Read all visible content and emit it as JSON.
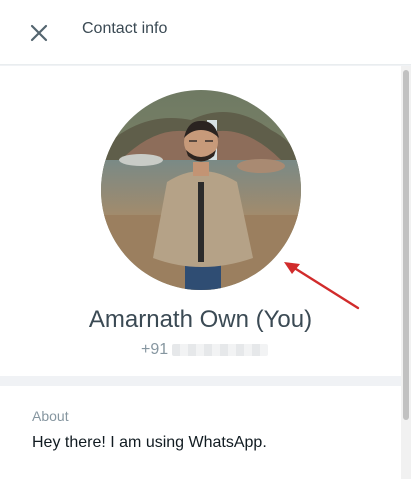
{
  "header": {
    "close_icon": "close-icon",
    "title": "Contact info"
  },
  "profile": {
    "photo": "profile-photo",
    "name": "Amarnath Own (You)",
    "phone_prefix": "+91",
    "phone_hidden": "blurred-digits"
  },
  "about": {
    "label": "About",
    "text": "Hey there! I am using WhatsApp."
  },
  "annotation": {
    "arrow_icon": "red-arrow-icon",
    "color": "#d12b2b"
  },
  "colors": {
    "panel_bg": "#f0f2f5",
    "card_bg": "#ffffff",
    "primary_text": "#3b4a54",
    "secondary_text": "#8696a0"
  }
}
